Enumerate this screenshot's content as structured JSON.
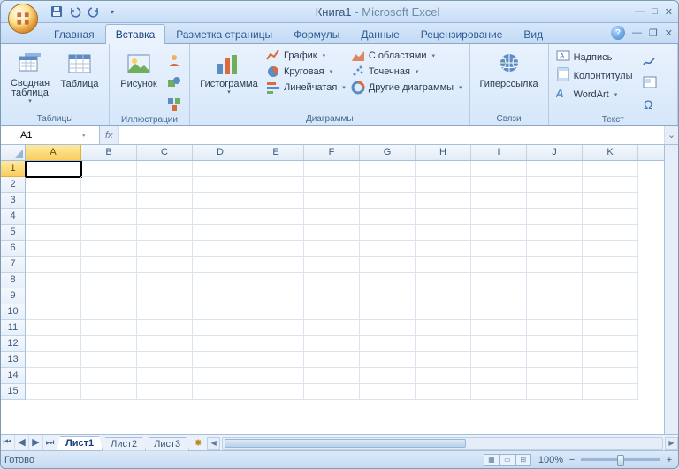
{
  "title": {
    "doc": "Книга1",
    "app": "Microsoft Excel"
  },
  "tabs": [
    "Главная",
    "Вставка",
    "Разметка страницы",
    "Формулы",
    "Данные",
    "Рецензирование",
    "Вид"
  ],
  "active_tab": 1,
  "ribbon": {
    "groups": {
      "tables": {
        "label": "Таблицы",
        "pivot": "Сводная\nтаблица",
        "table": "Таблица"
      },
      "illus": {
        "label": "Иллюстрации",
        "pic": "Рисунок"
      },
      "charts": {
        "label": "Диаграммы",
        "histogram": "Гистограмма",
        "items": [
          "График",
          "Круговая",
          "Линейчатая",
          "С областями",
          "Точечная",
          "Другие диаграммы"
        ]
      },
      "links": {
        "label": "Связи",
        "hyperlink": "Гиперссылка"
      },
      "text": {
        "label": "Текст",
        "items": [
          "Надпись",
          "Колонтитулы",
          "WordArt"
        ]
      }
    }
  },
  "namebox": "A1",
  "fx": "fx",
  "columns": [
    "A",
    "B",
    "C",
    "D",
    "E",
    "F",
    "G",
    "H",
    "I",
    "J",
    "K"
  ],
  "row_count": 15,
  "active_cell": {
    "r": 1,
    "c": "A"
  },
  "sheets": [
    "Лист1",
    "Лист2",
    "Лист3"
  ],
  "active_sheet": 0,
  "status": "Готово",
  "zoom": "100%"
}
